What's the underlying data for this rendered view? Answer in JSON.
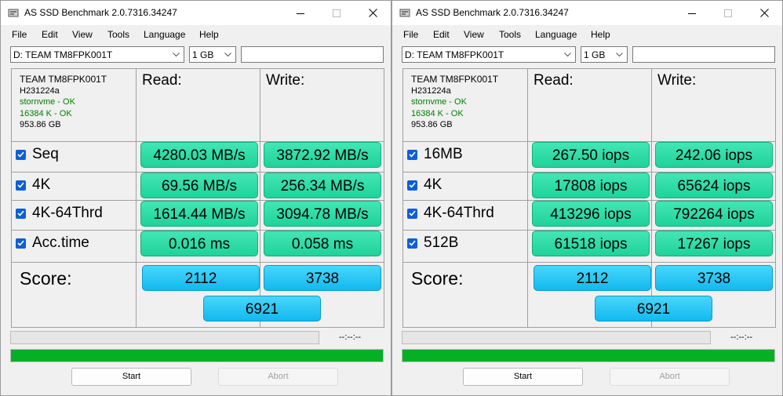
{
  "windows": [
    {
      "title": "AS SSD Benchmark 2.0.7316.34247",
      "menu": [
        "File",
        "Edit",
        "View",
        "Tools",
        "Language",
        "Help"
      ],
      "drive": "D: TEAM TM8FPK001T",
      "size": "1 GB",
      "device": {
        "name": "TEAM TM8FPK001T",
        "firmware": "H231224a",
        "driver": "stornvme - OK",
        "alignment": "16384 K - OK",
        "capacity": "953.86 GB"
      },
      "headers": {
        "read": "Read:",
        "write": "Write:"
      },
      "rows": [
        {
          "label": "Seq",
          "read": "4280.03 MB/s",
          "write": "3872.92 MB/s"
        },
        {
          "label": "4K",
          "read": "69.56 MB/s",
          "write": "256.34 MB/s"
        },
        {
          "label": "4K-64Thrd",
          "read": "1614.44 MB/s",
          "write": "3094.78 MB/s"
        },
        {
          "label": "Acc.time",
          "read": "0.016 ms",
          "write": "0.058 ms"
        }
      ],
      "score": {
        "label": "Score:",
        "read": "2112",
        "write": "3738",
        "total": "6921"
      },
      "time": "--:--:--",
      "progress": 1.0,
      "buttons": {
        "start": "Start",
        "abort": "Abort"
      }
    },
    {
      "title": "AS SSD Benchmark 2.0.7316.34247",
      "menu": [
        "File",
        "Edit",
        "View",
        "Tools",
        "Language",
        "Help"
      ],
      "drive": "D: TEAM TM8FPK001T",
      "size": "1 GB",
      "device": {
        "name": "TEAM TM8FPK001T",
        "firmware": "H231224a",
        "driver": "stornvme - OK",
        "alignment": "16384 K - OK",
        "capacity": "953.86 GB"
      },
      "headers": {
        "read": "Read:",
        "write": "Write:"
      },
      "rows": [
        {
          "label": "16MB",
          "read": "267.50 iops",
          "write": "242.06 iops"
        },
        {
          "label": "4K",
          "read": "17808 iops",
          "write": "65624 iops"
        },
        {
          "label": "4K-64Thrd",
          "read": "413296 iops",
          "write": "792264 iops"
        },
        {
          "label": "512B",
          "read": "61518 iops",
          "write": "17267 iops"
        }
      ],
      "score": {
        "label": "Score:",
        "read": "2112",
        "write": "3738",
        "total": "6921"
      },
      "time": "--:--:--",
      "progress": 1.0,
      "buttons": {
        "start": "Start",
        "abort": "Abort"
      }
    }
  ],
  "colors": {
    "result_green": "#2bdba6",
    "score_blue": "#1fc2f5",
    "progress_green": "#06b025",
    "ok_green": "#008000"
  }
}
